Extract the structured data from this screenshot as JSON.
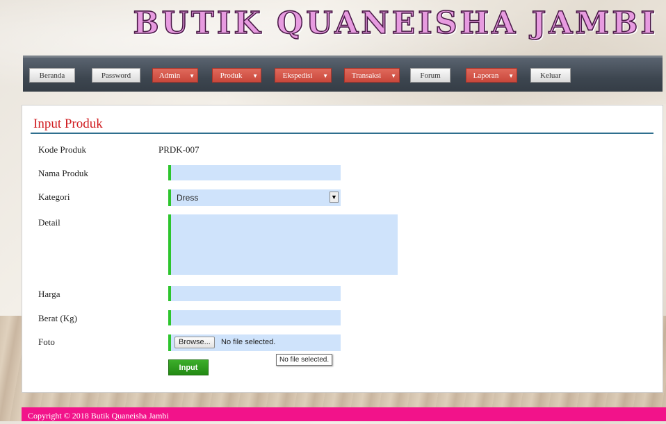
{
  "header": {
    "site_title": "BUTIK QUANEISHA JAMBI"
  },
  "nav": {
    "beranda": "Beranda",
    "password": "Password",
    "admin": "Admin",
    "produk": "Produk",
    "ekspedisi": "Ekspedisi",
    "transaksi": "Transaksi",
    "forum": "Forum",
    "laporan": "Laporan",
    "keluar": "Keluar",
    "caret": "▼"
  },
  "form": {
    "title": "Input Produk",
    "kode_label": "Kode Produk",
    "kode_value": "PRDK-007",
    "nama_label": "Nama Produk",
    "nama_value": "",
    "kategori_label": "Kategori",
    "kategori_value": "Dress",
    "detail_label": "Detail",
    "detail_value": "",
    "harga_label": "Harga",
    "harga_value": "",
    "berat_label": "Berat (Kg)",
    "berat_value": "",
    "foto_label": "Foto",
    "browse_label": "Browse...",
    "file_status": "No file selected.",
    "file_tooltip": "No file selected.",
    "submit_label": "Input"
  },
  "footer": {
    "copyright": "Copyright © 2018 Butik Quaneisha Jambi"
  },
  "colors": {
    "title_red": "#d01c20",
    "nav_dropdown": "#c9473b",
    "field_bg": "#cfe3fb",
    "field_accent": "#2dc52d",
    "footer_pink": "#f2138a",
    "submit_green": "#238a14"
  }
}
